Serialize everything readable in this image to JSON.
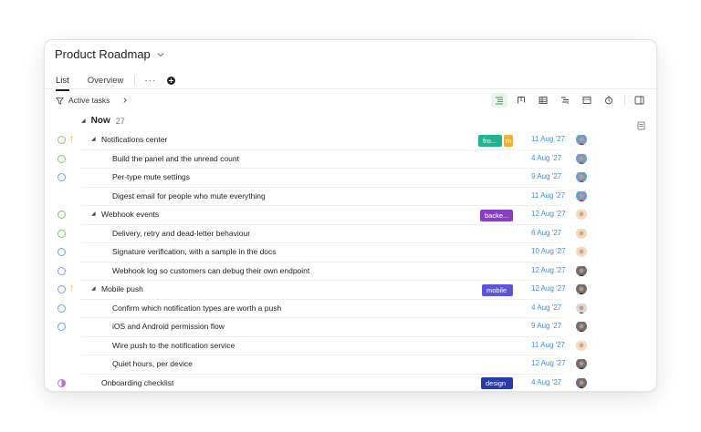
{
  "page": {
    "title": "Product Roadmap"
  },
  "tabs": [
    {
      "label": "List"
    },
    {
      "label": "Overview"
    }
  ],
  "tabs_more_label": "···",
  "filter": {
    "label": "Active tasks"
  },
  "toolbar_icons": [
    "list-view-icon",
    "board-view-icon",
    "table-view-icon",
    "timeline-view-icon",
    "calendar-view-icon",
    "clock-icon",
    "panel-toggle-icon"
  ],
  "group": {
    "name": "Now",
    "count": "27"
  },
  "colors": {
    "tag_fro": "#21b58f",
    "tag_m": "#f3b030",
    "tag_backend": "#8a3ec5",
    "tag_mobile": "#5a55d9",
    "tag_design": "#2a3aa6",
    "date": "#3b8fe0",
    "priority": "#f0a020"
  },
  "tasks": [
    {
      "name": "Notifications center",
      "parent": true,
      "status": "green",
      "priority": true,
      "tags": [
        "fro...",
        "m"
      ],
      "date": "11 Aug '27",
      "avatar": "avatar-blue"
    },
    {
      "name": "Build the panel and the unread count",
      "parent": false,
      "status": "green",
      "date": "4 Aug '27",
      "avatar": "avatar-blue"
    },
    {
      "name": "Per-type mute settings",
      "parent": false,
      "status": "blue",
      "date": "9 Aug '27",
      "avatar": "avatar-blue"
    },
    {
      "name": "Digest email for people who mute everything",
      "parent": false,
      "status": "none",
      "date": "11 Aug '27",
      "avatar": "avatar-blue"
    },
    {
      "name": "Webhook events",
      "parent": true,
      "status": "green",
      "tags": [
        "backe..."
      ],
      "date": "12 Aug '27",
      "avatar": "avatar-beige"
    },
    {
      "name": "Delivery, retry and dead-letter behaviour",
      "parent": false,
      "status": "green",
      "date": "6 Aug '27",
      "avatar": "avatar-beige"
    },
    {
      "name": "Signature verification, with a sample in the docs",
      "parent": false,
      "status": "blue",
      "date": "10 Aug '27",
      "avatar": "avatar-beige"
    },
    {
      "name": "Webhook log so customers can debug their own endpoint",
      "parent": false,
      "status": "blue",
      "date": "12 Aug '27",
      "avatar": "avatar-dark"
    },
    {
      "name": "Mobile push",
      "parent": true,
      "status": "blue",
      "priority": true,
      "tags": [
        "mobile"
      ],
      "date": "12 Aug '27",
      "avatar": "avatar-dark"
    },
    {
      "name": "Confirm which notification types are worth a push",
      "parent": false,
      "status": "blue",
      "date": "4 Aug '27",
      "avatar": "avatar-grey"
    },
    {
      "name": "iOS and Android permission flow",
      "parent": false,
      "status": "blue",
      "date": "9 Aug '27",
      "avatar": "avatar-dark"
    },
    {
      "name": "Wire push to the notification service",
      "parent": false,
      "status": "none",
      "date": "11 Aug '27",
      "avatar": "avatar-beige"
    },
    {
      "name": "Quiet hours, per device",
      "parent": false,
      "status": "none",
      "date": "12 Aug '27",
      "avatar": "avatar-dark"
    },
    {
      "name": "Onboarding checklist",
      "parent": false,
      "status": "half",
      "tags": [
        "design"
      ],
      "date": "4 Aug '27",
      "avatar": "avatar-dark"
    }
  ]
}
